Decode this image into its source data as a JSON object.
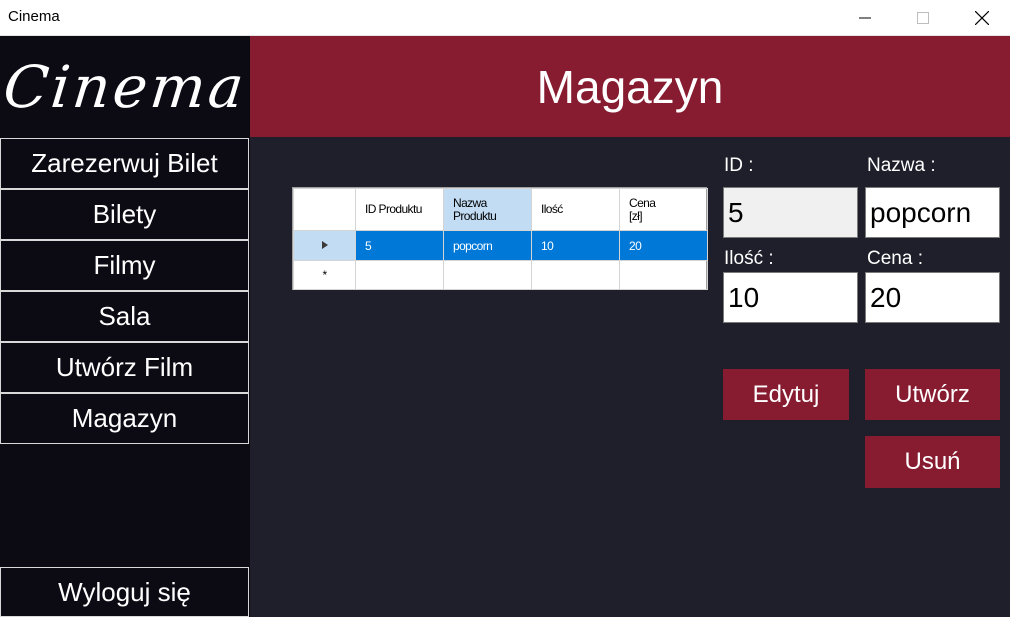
{
  "window": {
    "title": "Cinema"
  },
  "sidebar": {
    "logo": "Cinema",
    "items": [
      {
        "label": "Zarezerwuj Bilet"
      },
      {
        "label": "Bilety"
      },
      {
        "label": "Filmy"
      },
      {
        "label": "Sala"
      },
      {
        "label": "Utwórz Film"
      },
      {
        "label": "Magazyn"
      }
    ],
    "logout": "Wyloguj się"
  },
  "header": {
    "title": "Magazyn"
  },
  "grid": {
    "columns": [
      "ID Produktu",
      "Nazwa\nProduktu",
      "Ilość",
      "Cena\n[zł]"
    ],
    "rows": [
      {
        "id": "5",
        "name": "popcorn",
        "qty": "10",
        "price": "20"
      }
    ],
    "new_row_marker": "*"
  },
  "form": {
    "id_label": "ID :",
    "id_value": "5",
    "name_label": "Nazwa :",
    "name_value": "popcorn",
    "qty_label": "Ilość :",
    "qty_value": "10",
    "price_label": "Cena :",
    "price_value": "20"
  },
  "buttons": {
    "edit": "Edytuj",
    "create": "Utwórz",
    "delete": "Usuń"
  },
  "colors": {
    "accent": "#871c31",
    "sidebar_bg": "#0c0a13",
    "content_bg": "#1f1f2b",
    "selection": "#0078d7"
  }
}
